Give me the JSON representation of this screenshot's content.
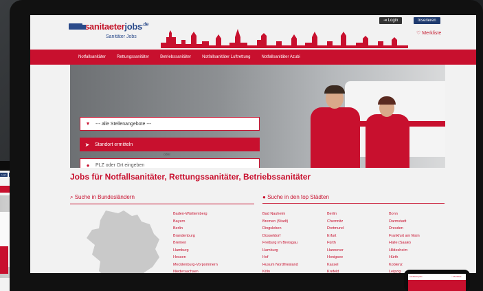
{
  "header": {
    "logo_main": "sanitaeter",
    "logo_accent": "jobs",
    "logo_tld": ".de",
    "logo_sub": "Sanitäter Jobs",
    "login_label": "Login",
    "inserieren_label": "Inserieren",
    "merkliste_label": "Merkliste"
  },
  "nav": {
    "items": [
      "Notfallsanitäter",
      "Rettungssanitäter",
      "Betriebssanitäter",
      "Notfallsanitäter Luftrettung",
      "Notfallsanitäter Azubi"
    ]
  },
  "search": {
    "select_value": "--- alle Stellenangebote ---",
    "standort_label": "Standort ermitteln",
    "oder_label": "oder",
    "plz_placeholder": "PLZ oder Ort eingeben"
  },
  "main": {
    "title": "Jobs für Notfallsanitäter, Rettungssanitäter, Betriebssanitäter",
    "bundeslaender_heading": "Suche in Bundesländern",
    "staedte_heading": "Suche in den top Städten",
    "bundeslaender": [
      "Baden-Württemberg",
      "Bayern",
      "Berlin",
      "Brandenburg",
      "Bremen",
      "Hamburg",
      "Hessen",
      "Mecklenburg-Vorpommern",
      "Niedersachsen"
    ],
    "staedte_col1": [
      "Bad Nauheim",
      "Bremen (Stadt)",
      "Dingsleben",
      "Düsseldorf",
      "Freiburg im Breisgau",
      "Hamburg",
      "Hof",
      "Husum Nordfriesland",
      "Köln"
    ],
    "staedte_col2": [
      "Berlin",
      "Chemnitz",
      "Dortmund",
      "Erfurt",
      "Fürth",
      "Hannover",
      "Honigsee",
      "Kassel",
      "Krefeld"
    ],
    "staedte_col3": [
      "Bonn",
      "Darmstadt",
      "Dresden",
      "Frankfurt am Main",
      "Halle (Saale)",
      "Hildesheim",
      "Hürth",
      "Koblenz",
      "Leipzig"
    ]
  },
  "tablet": {
    "login_label": "Login",
    "inserieren_label": "Inserieren",
    "merkliste_label": "Merkliste"
  },
  "phone": {
    "logo_label": "sanitaeterjobs",
    "merkliste_label": "Merkliste"
  },
  "colors": {
    "brand_red": "#c8102e",
    "brand_blue": "#2a4a8a"
  }
}
